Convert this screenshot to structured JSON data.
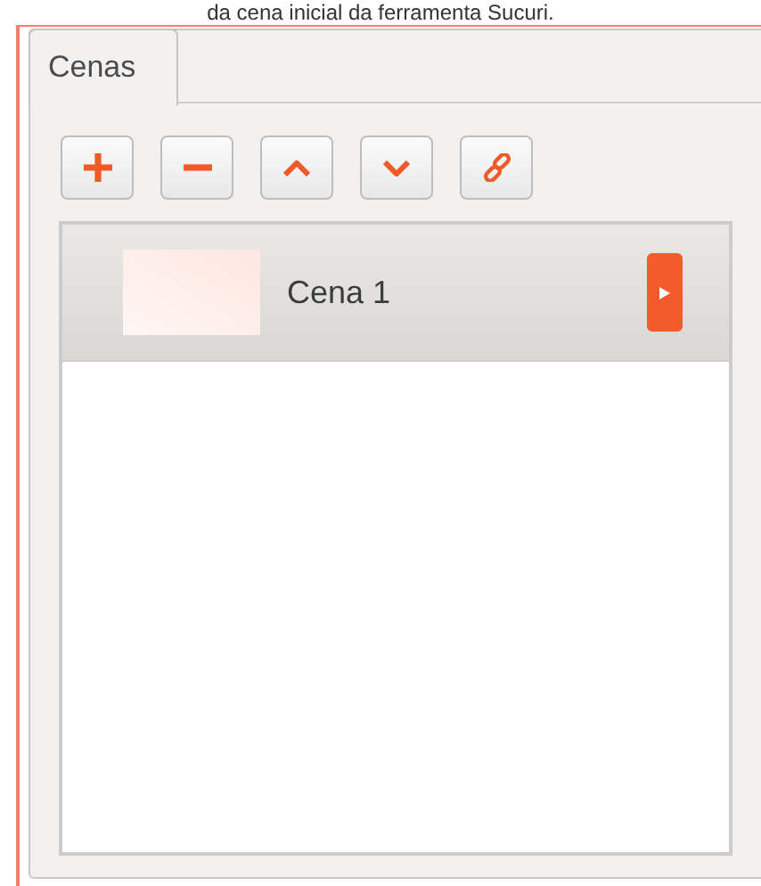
{
  "caption": "da cena inicial da ferramenta Sucuri.",
  "tabs": [
    {
      "label": "Cenas",
      "selected": true
    }
  ],
  "toolbar": [
    {
      "kind": "add"
    },
    {
      "kind": "remove"
    },
    {
      "kind": "up"
    },
    {
      "kind": "down"
    },
    {
      "kind": "link"
    }
  ],
  "scenes": [
    {
      "name": "Cena 1",
      "selected": true
    }
  ]
}
